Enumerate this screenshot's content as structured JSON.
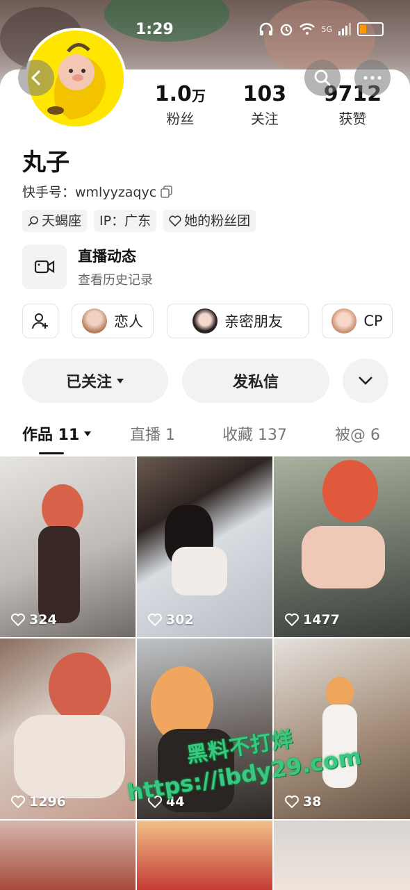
{
  "status_bar": {
    "time": "1:29",
    "network": "5G"
  },
  "profile": {
    "name": "丸子",
    "kuaishou_id_label": "快手号：wmlyyzaqyc",
    "stats": [
      {
        "num": "1.0",
        "unit": "万",
        "label": "粉丝"
      },
      {
        "num": "103",
        "unit": "",
        "label": "关注"
      },
      {
        "num": "9712",
        "unit": "",
        "label": "获赞"
      }
    ],
    "tags": [
      "天蝎座",
      "IP：广东",
      "她的粉丝团"
    ]
  },
  "live_history": {
    "title": "直播动态",
    "subtitle": "查看历史记录"
  },
  "relations": [
    "恋人",
    "亲密朋友",
    "CP"
  ],
  "actions": {
    "followed": "已关注",
    "message": "发私信"
  },
  "tabs": [
    {
      "label": "作品 11"
    },
    {
      "label": "直播 1"
    },
    {
      "label": "收藏 137"
    },
    {
      "label": "被@ 6"
    }
  ],
  "posts": [
    {
      "likes": "324"
    },
    {
      "likes": "302"
    },
    {
      "likes": "1477"
    },
    {
      "likes": "1296"
    },
    {
      "likes": "44"
    },
    {
      "likes": "38"
    }
  ],
  "watermark": {
    "line1": "黑料不打烊",
    "line2": "https://ibdy29.com"
  },
  "colors": {
    "accent_watermark": "#3dc585",
    "battery": "#ff9a00",
    "avatar_bg": "#ffe600"
  },
  "icons": [
    "back-icon",
    "search-icon",
    "more-icon",
    "copy-icon",
    "video-camera-icon",
    "add-friend-icon",
    "caret-down-icon",
    "chevron-down-icon",
    "heart-icon",
    "wifi-icon",
    "battery-icon"
  ]
}
